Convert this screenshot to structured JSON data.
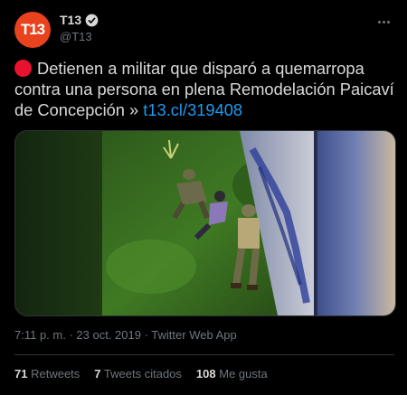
{
  "account": {
    "avatar_text": "T13",
    "name": "T13",
    "handle": "@T13"
  },
  "tweet": {
    "text": "Detienen a militar que disparó a quemarropa contra una persona en plena Remodelación Paicaví de Concepción » ",
    "link": "t13.cl/319408"
  },
  "meta": {
    "time": "7:11 p. m.",
    "sep": " · ",
    "date": "23 oct. 2019",
    "source": "Twitter Web App"
  },
  "stats": {
    "retweets_count": "71",
    "retweets_label": "Retweets",
    "quotes_count": "7",
    "quotes_label": "Tweets citados",
    "likes_count": "108",
    "likes_label": "Me gusta"
  },
  "icons": {
    "verified": "verified-badge-icon",
    "more": "more-horizontal-icon",
    "status": "red-circle-emoji"
  },
  "colors": {
    "background": "#000000",
    "text": "#d9d9d9",
    "muted": "#6e767d",
    "link": "#1d9bf0",
    "brand": "#e8421f",
    "divider": "#2f3336"
  }
}
